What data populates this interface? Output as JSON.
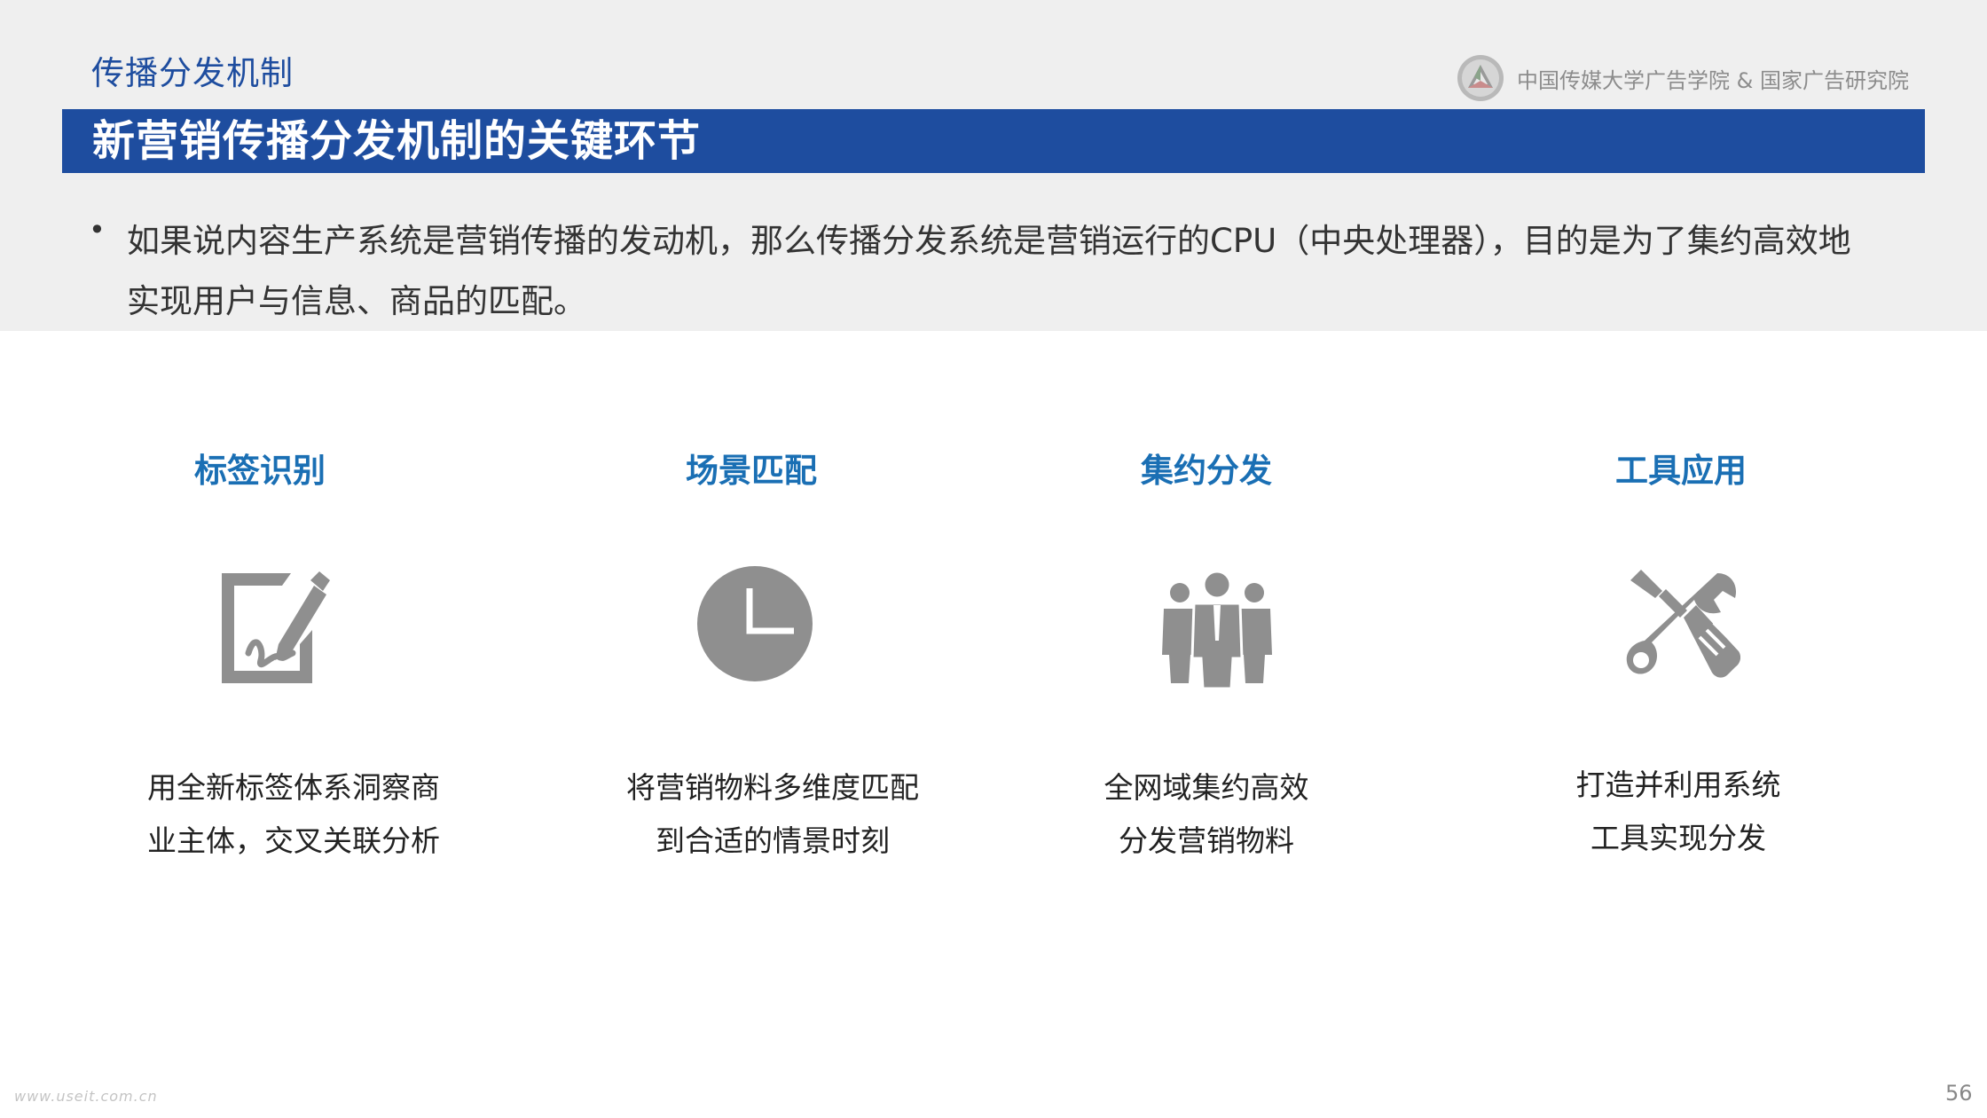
{
  "header": {
    "section_title": "传播分发机制",
    "org_text": "中国传媒大学广告学院 & 国家广告研究院",
    "logo_icon": "triangle-emblem-icon"
  },
  "title_bar": {
    "text": "新营销传播分发机制的关键环节",
    "color": "#1e4d9f"
  },
  "bullet": {
    "line1": "如果说内容生产系统是营销传播的发动机，那么传播分发系统是营销运行的CPU（中央处理器），目的是为了集约高效地",
    "line2": "实现用户与信息、商品的匹配。"
  },
  "columns": [
    {
      "title": "标签识别",
      "icon": "sign-document-icon",
      "desc_line1": "用全新标签体系洞察商",
      "desc_line2": "业主体，交叉关联分析"
    },
    {
      "title": "场景匹配",
      "icon": "clock-icon",
      "desc_line1": "将营销物料多维度匹配",
      "desc_line2": "到合适的情景时刻"
    },
    {
      "title": "集约分发",
      "icon": "people-group-icon",
      "desc_line1": "全网域集约高效",
      "desc_line2": "分发营销物料"
    },
    {
      "title": "工具应用",
      "icon": "tools-icon",
      "desc_line1": "打造并利用系统",
      "desc_line2": "工具实现分发"
    }
  ],
  "footer": {
    "url": "www.useit.com.cn",
    "page_number": "56"
  }
}
